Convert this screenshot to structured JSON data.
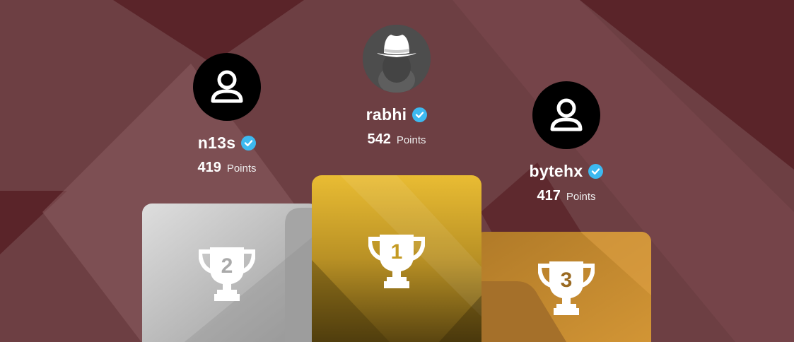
{
  "leaderboard": {
    "first": {
      "name": "rabhi",
      "points": "542",
      "points_label": "Points",
      "rank": "1",
      "avatar_icon": "hat-avatar-icon",
      "verified": true
    },
    "second": {
      "name": "n13s",
      "points": "419",
      "points_label": "Points",
      "rank": "2",
      "avatar_icon": "user-icon",
      "verified": true
    },
    "third": {
      "name": "bytehx",
      "points": "417",
      "points_label": "Points",
      "rank": "3",
      "avatar_icon": "user-icon",
      "verified": true
    }
  },
  "colors": {
    "background": "#6d3f43",
    "verified": "#3db9f0",
    "gold": "#e0b52c",
    "silver": "#c9c9c9",
    "bronze": "#c9892f"
  }
}
